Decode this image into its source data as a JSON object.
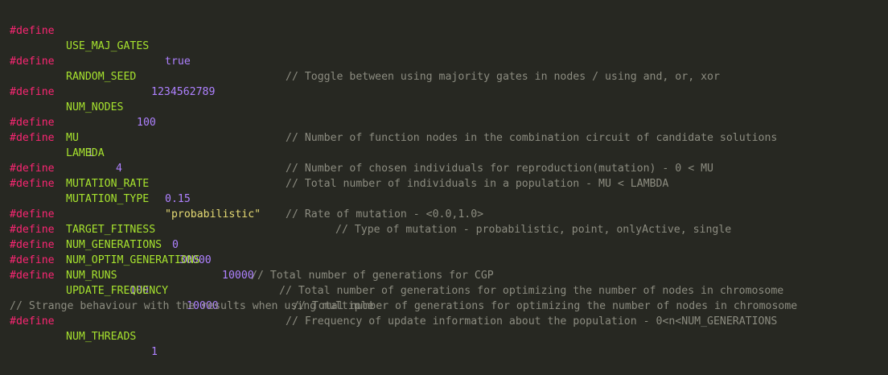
{
  "editor": {
    "keyword": "#define",
    "lines": [
      {
        "name": "USE_MAJ_GATES",
        "value": "true",
        "comment": "// Toggle between using majority gates in nodes / using and, or, xor"
      },
      {
        "blank": true
      },
      {
        "name": "RANDOM_SEED",
        "value": "1234562789"
      },
      {
        "blank": true
      },
      {
        "name": "NUM_NODES",
        "value": "100",
        "comment": "// Number of function nodes in the combination circuit of candidate solutions"
      },
      {
        "blank": true
      },
      {
        "name": "MU",
        "value": "1",
        "comment": "// Number of chosen individuals for reproduction(mutation) - 0 < MU"
      },
      {
        "name": "LAMBDA",
        "value": "4",
        "comment": "// Total number of individuals in a population - MU < LAMBDA"
      },
      {
        "blank": true
      },
      {
        "name": "MUTATION_RATE",
        "value": "0.15",
        "comment": "// Rate of mutation - <0.0,1.0>"
      },
      {
        "name": "MUTATION_TYPE",
        "value": "\"probabilistic\"",
        "comment": "// Type of mutation - probabilistic, point, onlyActive, single"
      },
      {
        "blank": true
      },
      {
        "name": "TARGET_FITNESS",
        "value": "0"
      },
      {
        "name": "NUM_GENERATIONS",
        "value": "30000",
        "comment": "// Total number of generations for CGP"
      },
      {
        "name": "NUM_OPTIM_GENERATIONS",
        "value": "10000",
        "comment": "// Total number of generations for optimizing the number of nodes in chromosome"
      },
      {
        "name": "NUM_RUNS",
        "value": "100",
        "comment": "// Total number of generations for optimizing the number of nodes in chromosome"
      },
      {
        "name": "UPDATE_FREQUENCY",
        "value": "10000",
        "comment": "// Frequency of update information about the population - 0<n<NUM_GENERATIONS"
      },
      {
        "blank": true
      },
      {
        "comment_only": "// Strange behaviour with the results when using multiple"
      },
      {
        "name": "NUM_THREADS",
        "value": "1"
      }
    ]
  }
}
